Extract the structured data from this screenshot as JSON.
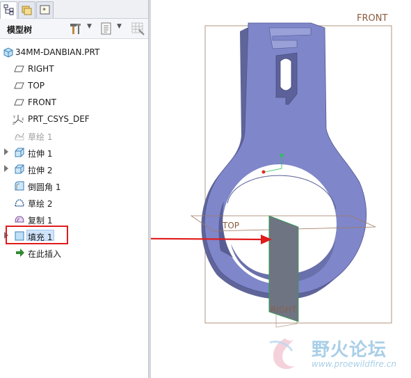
{
  "tabs": [
    {
      "icon": "model-tree-tab-icon"
    },
    {
      "icon": "folder-browser-tab-icon"
    },
    {
      "icon": "favorites-tab-icon"
    }
  ],
  "tree_panel": {
    "title": "模型树",
    "tools_icon": "hammer-settings-icon",
    "show_icon": "show-list-icon",
    "filter_icon": "grid-filter-icon"
  },
  "tree": {
    "root": "34MM-DANBIAN.PRT",
    "items": [
      {
        "label": "RIGHT",
        "icon": "datum-plane-icon",
        "state": "normal"
      },
      {
        "label": "TOP",
        "icon": "datum-plane-icon",
        "state": "normal"
      },
      {
        "label": "FRONT",
        "icon": "datum-plane-icon",
        "state": "normal"
      },
      {
        "label": "PRT_CSYS_DEF",
        "icon": "csys-icon",
        "state": "normal"
      },
      {
        "label": "草绘 1",
        "icon": "sketch-icon",
        "state": "suppressed"
      },
      {
        "label": "拉伸 1",
        "icon": "extrude-icon",
        "state": "normal",
        "expandable": true
      },
      {
        "label": "拉伸 2",
        "icon": "extrude-icon",
        "state": "normal",
        "expandable": true
      },
      {
        "label": "倒圆角 1",
        "icon": "round-icon",
        "state": "normal"
      },
      {
        "label": "草绘 2",
        "icon": "sketch-icon",
        "state": "normal"
      },
      {
        "label": "复制 1",
        "icon": "copy-icon",
        "state": "normal"
      },
      {
        "label": "填充 1",
        "icon": "fill-icon",
        "state": "selected",
        "expandable": true
      },
      {
        "label": "在此插入",
        "icon": "insert-here-arrow-icon",
        "state": "insert"
      }
    ]
  },
  "viewport": {
    "datum_labels": {
      "front": "FRONT",
      "top": "TOP",
      "right": "RIGHT"
    },
    "part_color": "#7f86c9",
    "fill_surface_color": "#6f7482",
    "datum_color": "#8a5a3c",
    "callout_color": "#e01b1b"
  },
  "watermark": {
    "title": "野火论坛",
    "url": "www.proewildfire.cn"
  }
}
